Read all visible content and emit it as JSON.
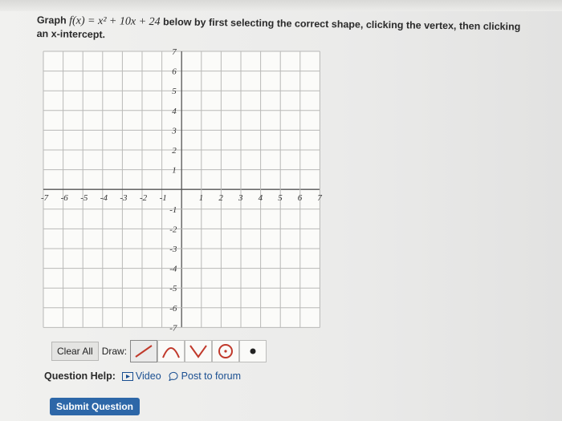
{
  "question": {
    "prefix": "Graph",
    "function_text": "f(x) = x² + 10x + 24",
    "suffix_line1": "below by first selecting the correct shape, clicking the vertex, then clicking",
    "line2": "an x-intercept."
  },
  "graph": {
    "x_ticks": [
      "-7",
      "-6",
      "-5",
      "-4",
      "-3",
      "-2",
      "-1",
      "1",
      "2",
      "3",
      "4",
      "5",
      "6",
      "7"
    ],
    "y_ticks_pos": [
      "7",
      "6",
      "5",
      "4",
      "3",
      "2",
      "1"
    ],
    "y_ticks_neg": [
      "-1",
      "-2",
      "-3",
      "-4",
      "-5",
      "-6",
      "-7"
    ],
    "x_range": [
      -7,
      7
    ],
    "y_range": [
      -7,
      7
    ],
    "grid": true
  },
  "toolbar": {
    "clear_all_label": "Clear All",
    "draw_label": "Draw:",
    "tools": [
      "line-tool-icon",
      "parabola-down-tool-icon",
      "absolute-value-tool-icon",
      "circle-tool-icon",
      "point-tool-icon"
    ]
  },
  "help": {
    "label": "Question Help:",
    "video_label": "Video",
    "forum_label": "Post to forum"
  },
  "submit_label": "Submit Question",
  "colors": {
    "link": "#1a4f91",
    "submit_bg": "#2d67a8",
    "tool_red": "#c0392b",
    "tool_blue": "#1a4f91"
  }
}
